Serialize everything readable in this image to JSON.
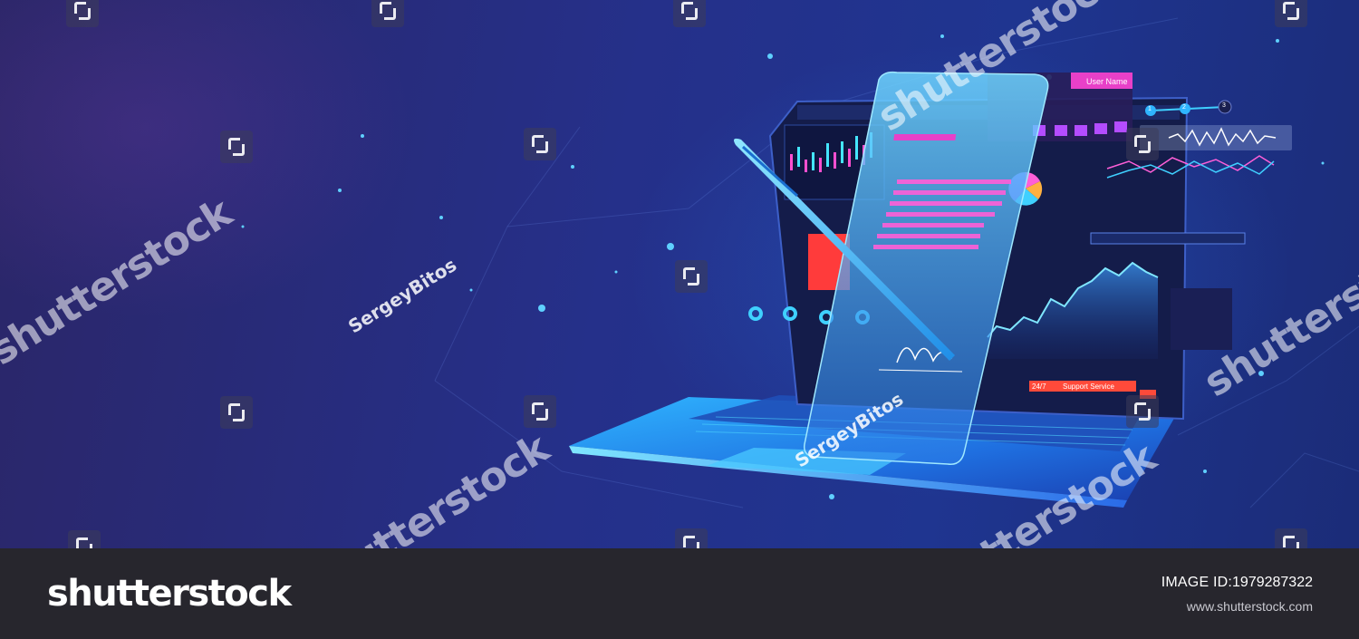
{
  "image": {
    "subject": "laptop-with-digital-contract-and-pen",
    "colors": {
      "background": "#26307f",
      "accent": "#2fd8ff",
      "highlight": "#e840c8",
      "alert": "#ff3b3b"
    }
  },
  "screen": {
    "header_user": "User Name",
    "support_label": "Support Service",
    "support_tag": "24/7",
    "steps": [
      "1",
      "2",
      "3"
    ]
  },
  "watermarks": {
    "brand": "shutterstock",
    "author": "SergeyBitos"
  },
  "footer": {
    "logo": "shutterstock",
    "image_id_label": "IMAGE ID:",
    "image_id": "1979287322",
    "url": "www.shutterstock.com"
  }
}
